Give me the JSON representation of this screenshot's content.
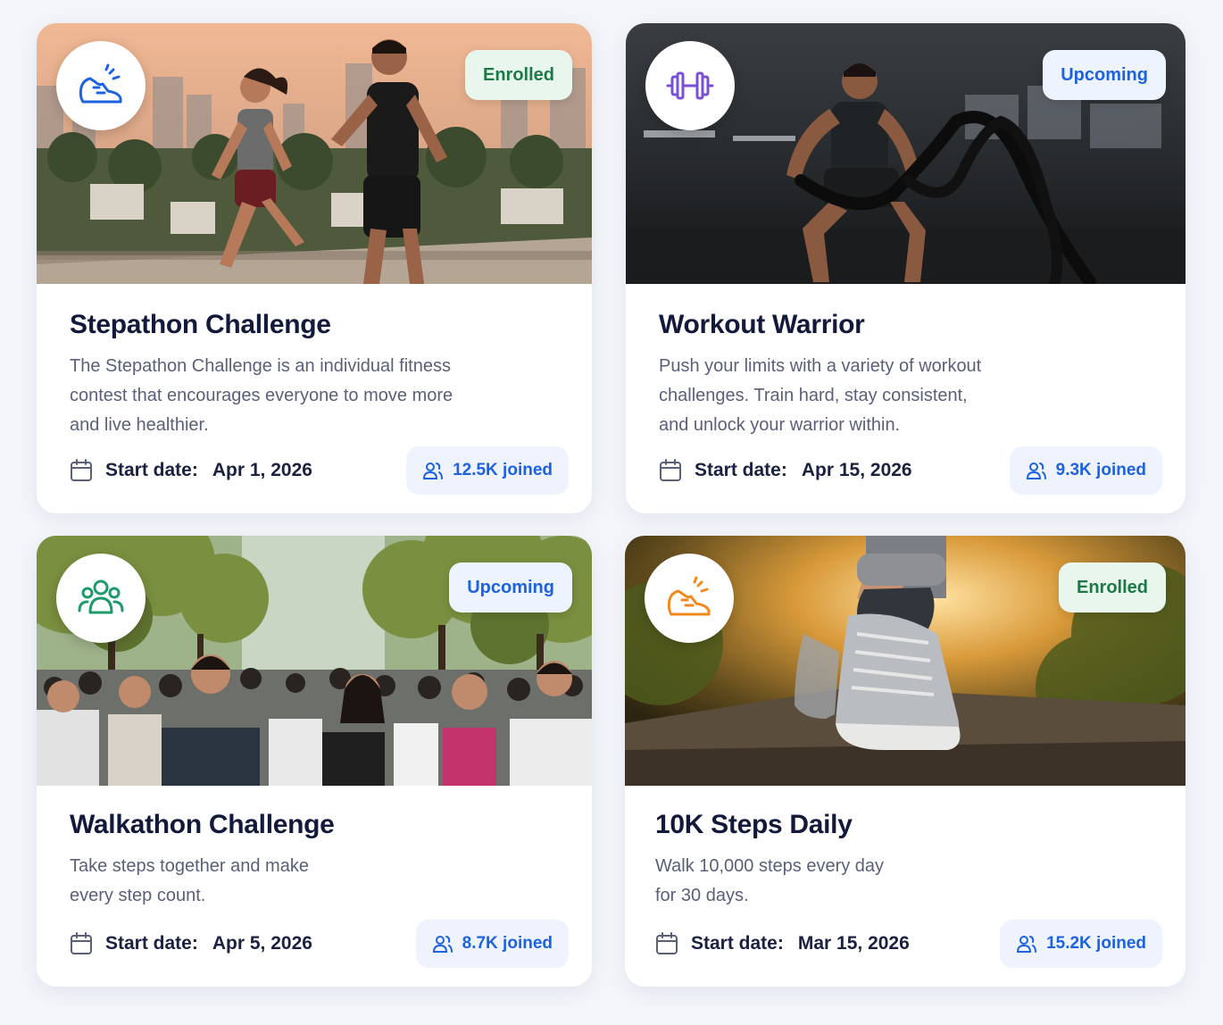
{
  "cards": [
    {
      "title": "Stepathon Challenge",
      "description": "The Stepathon Challenge is an individual fitness\ncontest that encourages everyone to move more\nand live healthier.",
      "status": "Enrolled",
      "start_label": "Start date:",
      "start_date": "Apr 1, 2026",
      "joined": "12.5K joined",
      "icon": "running-shoe-icon",
      "icon_color": "#1d63e0"
    },
    {
      "title": "Workout Warrior",
      "description": "Push your limits with a variety of workout\nchallenges. Train hard, stay consistent,\nand unlock your warrior within.",
      "status": "Upcoming",
      "start_label": "Start date:",
      "start_date": "Apr 15, 2026",
      "joined": "9.3K joined",
      "icon": "dumbbell-icon",
      "icon_color": "#7a4fd6"
    },
    {
      "title": "Walkathon Challenge",
      "description": "Take steps together and make\nevery step count.",
      "status": "Upcoming",
      "start_label": "Start date:",
      "start_date": "Apr 5, 2026",
      "joined": "8.7K joined",
      "icon": "group-icon",
      "icon_color": "#1f9a6a"
    },
    {
      "title": "10K Steps Daily",
      "description": "Walk 10,000 steps every day\nfor 30 days.",
      "status": "Enrolled",
      "start_label": "Start date:",
      "start_date": "Mar 15, 2026",
      "joined": "15.2K joined",
      "icon": "running-shoe-icon",
      "icon_color": "#f08a1c"
    }
  ],
  "colors": {
    "enrolled_bg": "#e8f6ee",
    "enrolled_text": "#1b7a45",
    "upcoming_bg": "#edf3ff",
    "upcoming_text": "#1d63e0",
    "title": "#12193a"
  }
}
